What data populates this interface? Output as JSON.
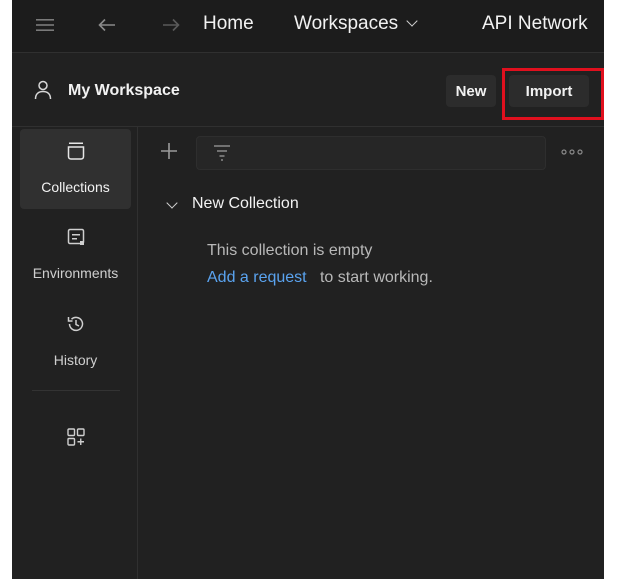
{
  "topbar": {
    "nav_items": [
      "Home",
      "Workspaces",
      "API Network"
    ],
    "icons": [
      "menu-icon",
      "back-arrow-icon",
      "forward-arrow-icon",
      "chevron-down-icon"
    ]
  },
  "workspace": {
    "title": "My Workspace",
    "new_label": "New",
    "import_label": "Import"
  },
  "sidebar": {
    "items": [
      {
        "label": "Collections",
        "icon": "collections-icon",
        "active": true
      },
      {
        "label": "Environments",
        "icon": "environments-icon",
        "active": false
      },
      {
        "label": "History",
        "icon": "history-icon",
        "active": false
      }
    ],
    "extra_icon": "add-widget-icon"
  },
  "main": {
    "collection_name": "New Collection",
    "empty_message": "This collection is empty",
    "add_request_link": "Add a request",
    "add_request_suffix": "to start working."
  },
  "colors": {
    "background": "#212121",
    "topbar": "#1c1c1c",
    "button": "#2c2c2c",
    "link": "#5aa3ef",
    "highlight": "#e0101e"
  }
}
